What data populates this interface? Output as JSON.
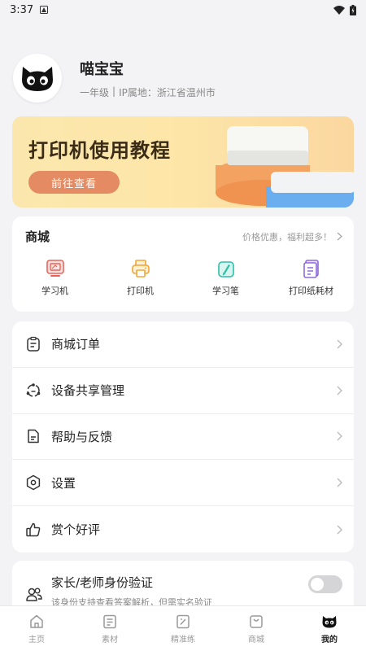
{
  "status": {
    "time": "3:37"
  },
  "profile": {
    "name": "喵宝宝",
    "grade": "一年级",
    "separator": "|",
    "ip": "IP属地：浙江省温州市"
  },
  "banner": {
    "title": "打印机使用教程",
    "button": "前往查看"
  },
  "shop": {
    "title": "商城",
    "hint": "价格优惠，福利超多！",
    "items": [
      {
        "label": "学习机",
        "icon": "learning-machine-icon",
        "color": "#e8645a"
      },
      {
        "label": "打印机",
        "icon": "printer-icon",
        "color": "#f2a535"
      },
      {
        "label": "学习笔",
        "icon": "learning-pen-icon",
        "color": "#2dbfa7"
      },
      {
        "label": "打印纸耗材",
        "icon": "paper-icon",
        "color": "#8e6bd8"
      }
    ]
  },
  "menu": [
    {
      "label": "商城订单",
      "icon": "clipboard-icon"
    },
    {
      "label": "设备共享管理",
      "icon": "share-icon"
    },
    {
      "label": "帮助与反馈",
      "icon": "document-icon"
    },
    {
      "label": "设置",
      "icon": "settings-icon"
    },
    {
      "label": "赏个好评",
      "icon": "thumbs-up-icon"
    }
  ],
  "verify": {
    "title": "家长/老师身份验证",
    "subtitle": "该身份支持查看答案解析，但需实名验证",
    "enabled": false
  },
  "tabs": [
    {
      "label": "主页",
      "icon": "home-icon",
      "active": false
    },
    {
      "label": "素材",
      "icon": "material-icon",
      "active": false
    },
    {
      "label": "精准练",
      "icon": "practice-icon",
      "active": false
    },
    {
      "label": "商城",
      "icon": "shop-icon",
      "active": false
    },
    {
      "label": "我的",
      "icon": "cat-icon",
      "active": true
    }
  ]
}
